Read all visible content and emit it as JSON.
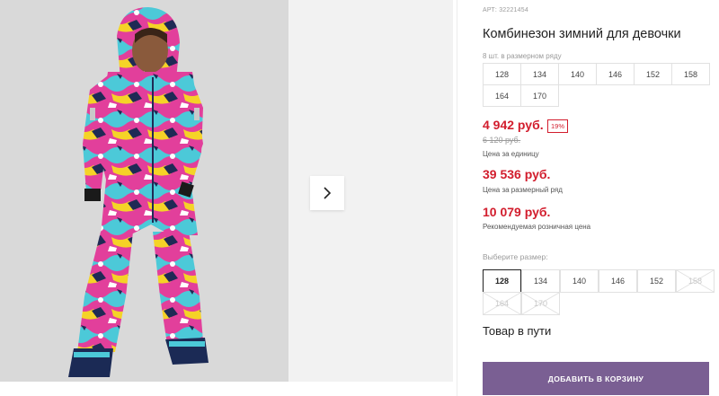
{
  "product": {
    "article": "АРТ: 32221454",
    "title": "Комбинезон зимний для девочки",
    "row_note": "8 шт. в размерном ряду",
    "sizes_in_row": [
      "128",
      "134",
      "140",
      "146",
      "152",
      "158",
      "164",
      "170"
    ],
    "price_unit": "4 942 руб.",
    "discount_badge": "19%",
    "old_price": "6 120 руб.",
    "price_unit_caption": "Цена за единицу",
    "price_row": "39 536 руб.",
    "price_row_caption": "Цена за размерный ряд",
    "price_retail": "10 079 руб.",
    "price_retail_caption": "Рекомендуемая розничная цена",
    "choose_size_label": "Выберите размер:",
    "size_options": [
      {
        "label": "128",
        "state": "selected"
      },
      {
        "label": "134",
        "state": "available"
      },
      {
        "label": "140",
        "state": "available"
      },
      {
        "label": "146",
        "state": "available"
      },
      {
        "label": "152",
        "state": "available"
      },
      {
        "label": "158",
        "state": "unavailable"
      },
      {
        "label": "164",
        "state": "unavailable"
      },
      {
        "label": "170",
        "state": "unavailable"
      }
    ],
    "status": "Товар в пути",
    "add_to_cart": "ДОБАВИТЬ В КОРЗИНУ"
  },
  "gallery": {
    "next_icon": "chevron-right-icon"
  },
  "colors": {
    "price_red": "#d21d2d",
    "button_purple": "#7a5f93",
    "snowsuit_pink": "#e23f9b",
    "snowsuit_cyan": "#4cc9d8",
    "snowsuit_yellow": "#f5d327"
  }
}
